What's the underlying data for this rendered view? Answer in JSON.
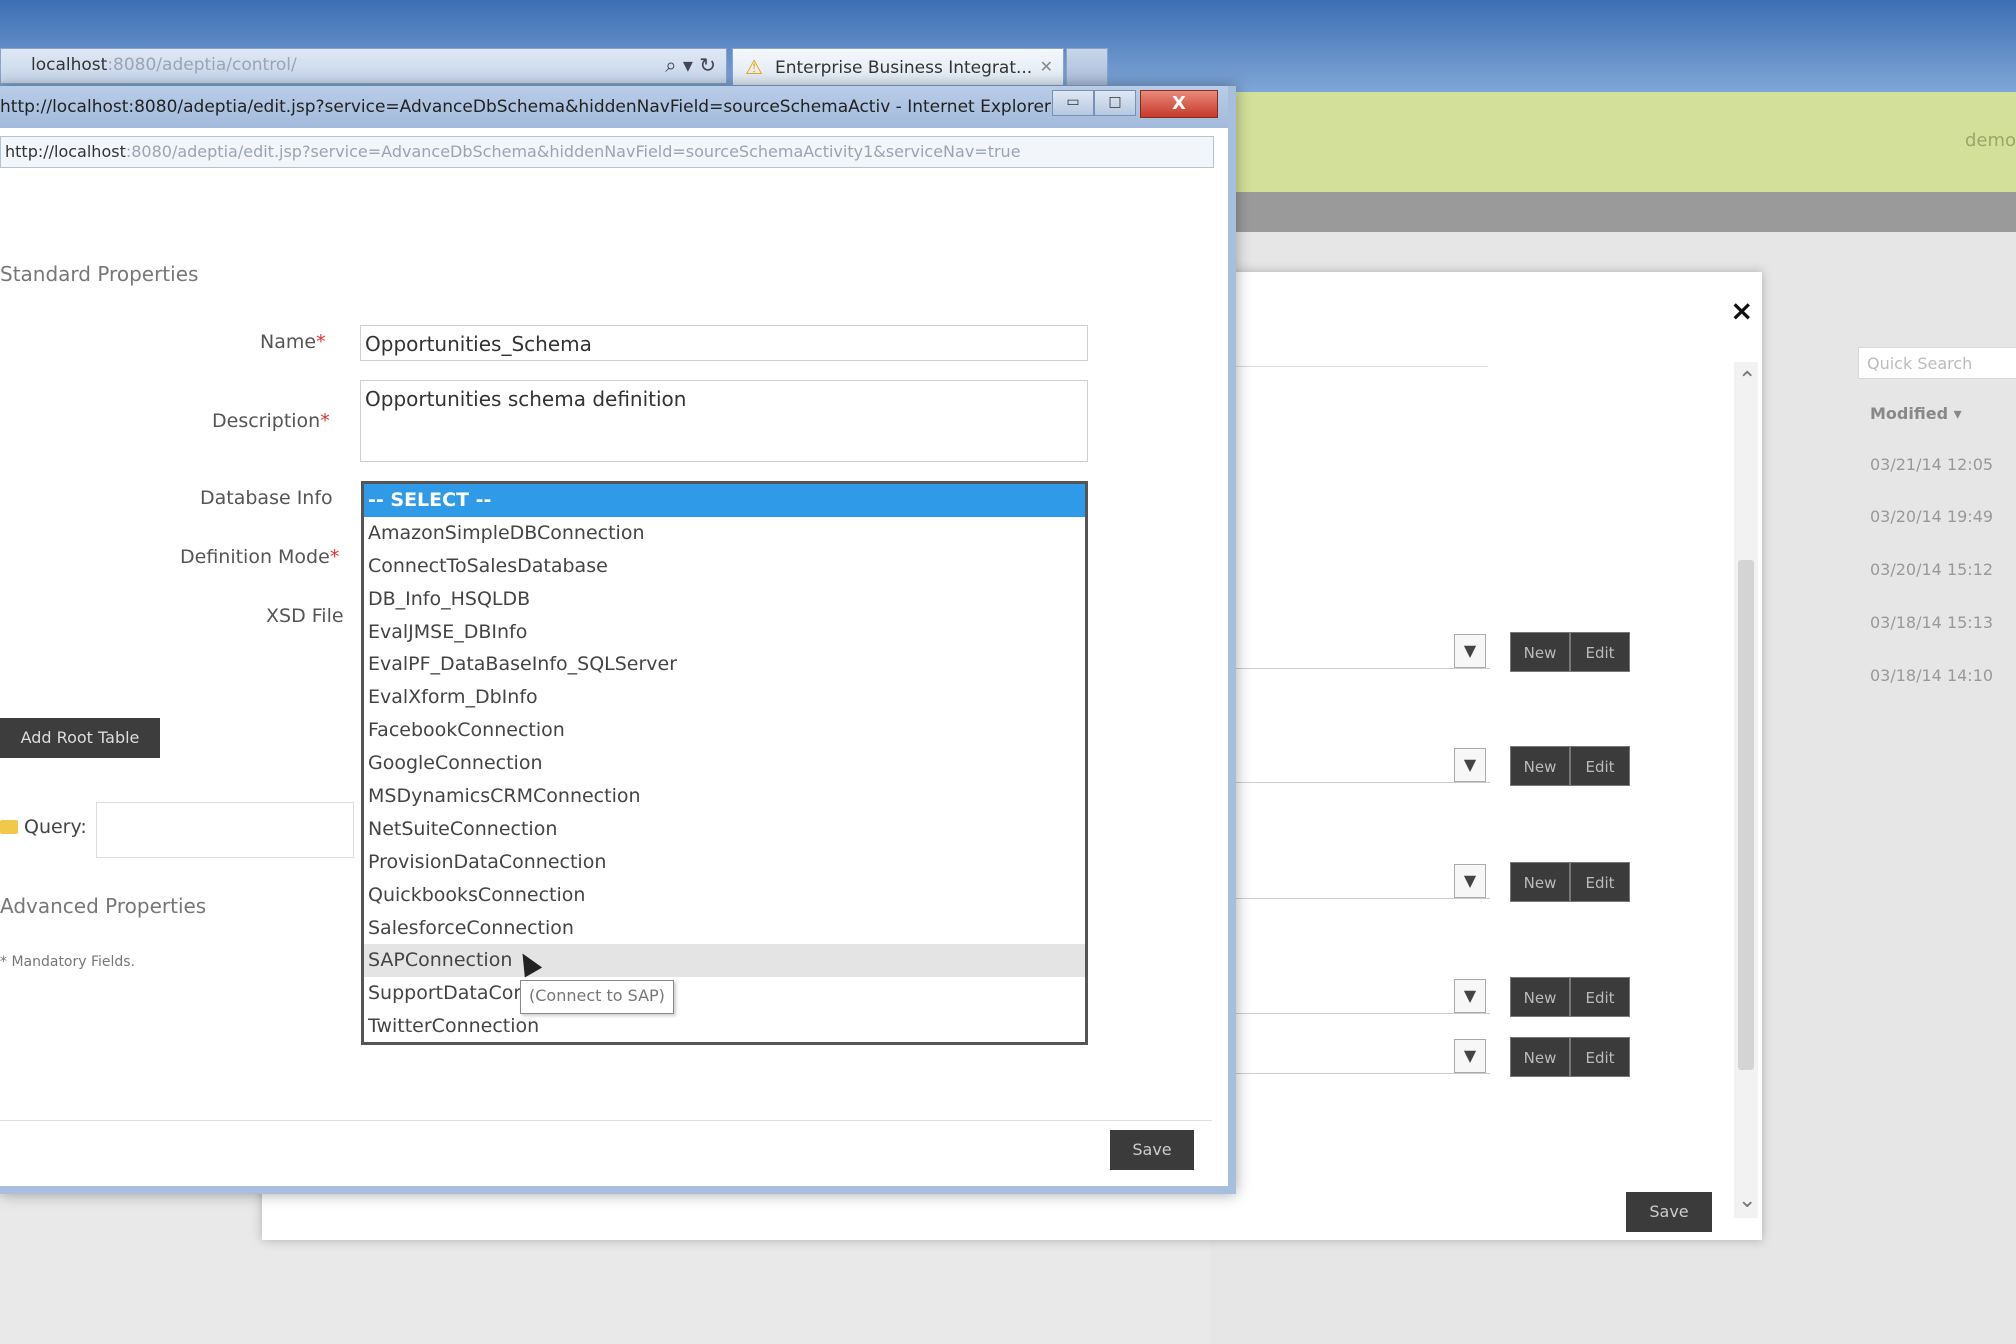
{
  "browser": {
    "address_host": "localhost",
    "address_rest": ":8080/adeptia/control/",
    "tab_title": "Enterprise Business Integrat...",
    "user_hint": "demo"
  },
  "popup": {
    "window_title": "http://localhost:8080/adeptia/edit.jsp?service=AdvanceDbSchema&hiddenNavField=sourceSchemaActiv - Internet Explorer",
    "url_host": "http://localhost",
    "url_rest": ":8080/adeptia/edit.jsp?service=AdvanceDbSchema&hiddenNavField=sourceSchemaActivity1&serviceNav=true",
    "standard_properties": "Standard Properties",
    "name_label": "Name",
    "name_value": "Opportunities_Schema",
    "description_label": "Description",
    "description_value": "Opportunities schema definition",
    "database_info_label": "Database Info",
    "definition_mode_label": "Definition Mode",
    "xsd_file_label": "XSD File",
    "add_root_table": "Add Root Table",
    "query_label": "Query:",
    "advanced_properties": "Advanced Properties",
    "mandatory_note": "* Mandatory Fields.",
    "save": "Save",
    "required_mark": "*",
    "database_options": [
      "-- SELECT --",
      "AmazonSimpleDBConnection",
      "ConnectToSalesDatabase",
      "DB_Info_HSQLDB",
      "EvalJMSE_DBInfo",
      "EvalPF_DataBaseInfo_SQLServer",
      "EvalXform_DbInfo",
      "FacebookConnection",
      "GoogleConnection",
      "MSDynamicsCRMConnection",
      "NetSuiteConnection",
      "ProvisionDataConnection",
      "QuickbooksConnection",
      "SalesforceConnection",
      "SAPConnection",
      "SupportDataConnection",
      "TwitterConnection"
    ],
    "tooltip": "(Connect to SAP)"
  },
  "middle_dialog": {
    "close": "×",
    "new": "New",
    "edit": "Edit",
    "save": "Save"
  },
  "background_list": {
    "quick_search_placeholder": "Quick Search",
    "modified_header": "Modified ▾",
    "dates": [
      "03/21/14 12:05",
      "03/20/14 19:49",
      "03/20/14 15:12",
      "03/18/14 15:13",
      "03/18/14 14:10"
    ]
  }
}
